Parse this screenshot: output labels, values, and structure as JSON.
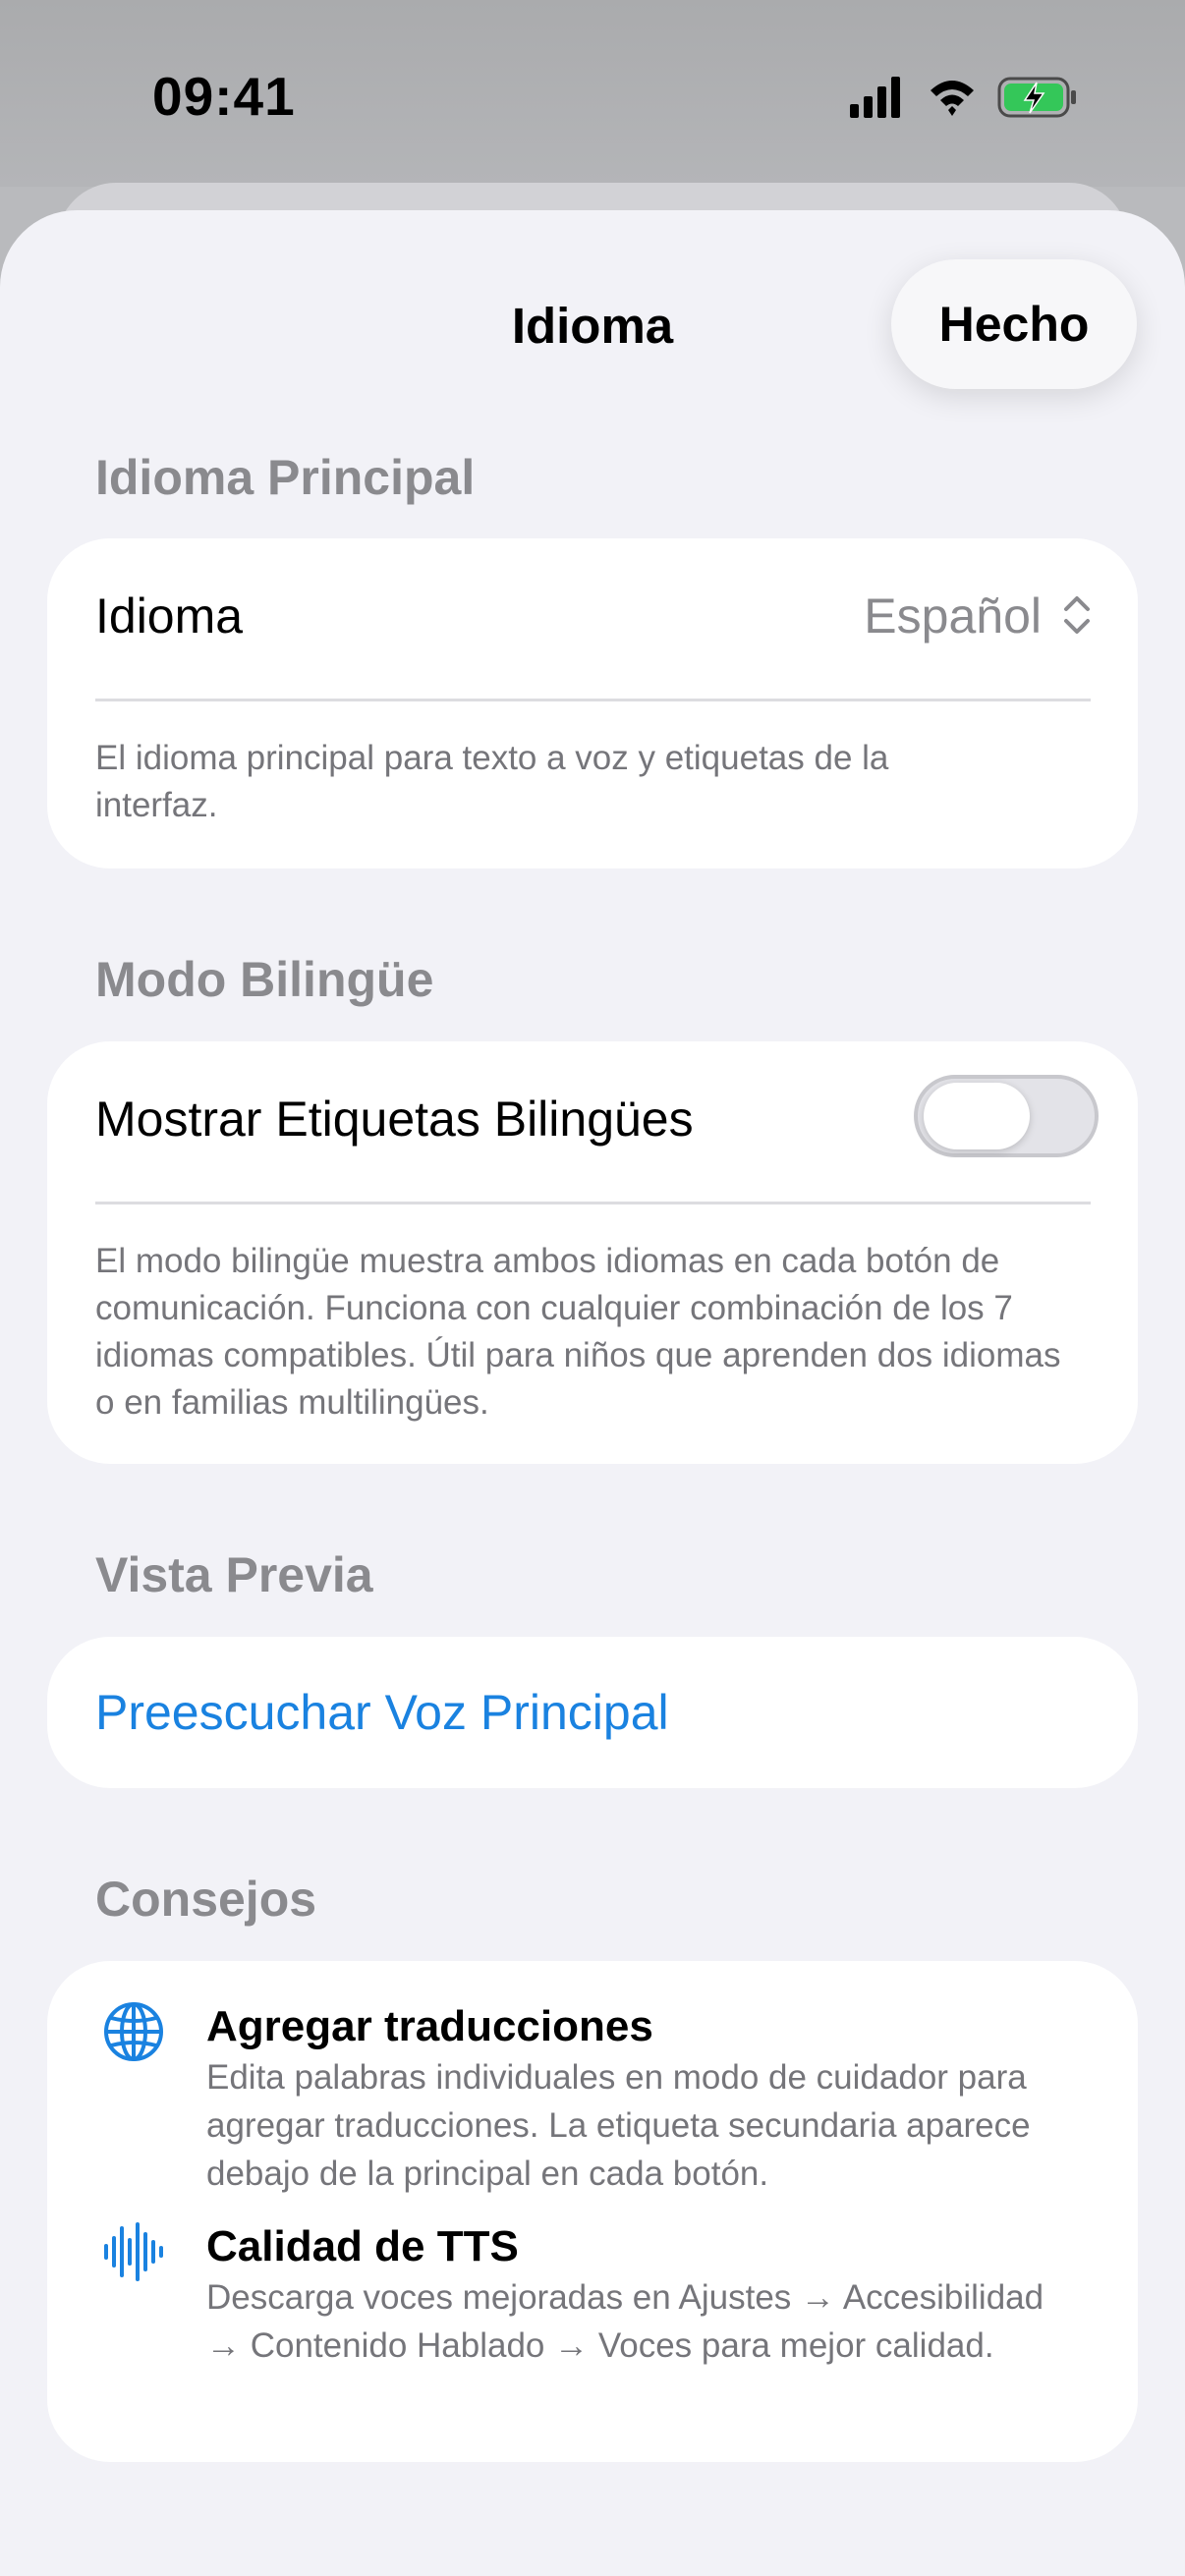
{
  "status_bar": {
    "time": "09:41"
  },
  "nav": {
    "title": "Idioma",
    "done_label": "Hecho"
  },
  "primary_language": {
    "header": "Idioma Principal",
    "row_label": "Idioma",
    "row_value": "Español",
    "footnote": "El idioma principal para texto a voz y etiquetas de la interfaz."
  },
  "bilingual": {
    "header": "Modo Bilingüe",
    "toggle_label": "Mostrar Etiquetas Bilingües",
    "toggle_on": false,
    "footnote": "El modo bilingüe muestra ambos idiomas en cada botón de comunicación. Funciona con cualquier combinación de los 7 idiomas compatibles. Útil para niños que aprenden dos idiomas o en familias multilingües."
  },
  "preview": {
    "header": "Vista Previa",
    "button_label": "Preescuchar Voz Principal"
  },
  "tips": {
    "header": "Consejos",
    "items": [
      {
        "icon": "globe-icon",
        "title": "Agregar traducciones",
        "text": "Edita palabras individuales en modo de cuidador para agregar traducciones. La etiqueta secundaria aparece debajo de la principal en cada botón."
      },
      {
        "icon": "waveform-icon",
        "title": "Calidad de TTS",
        "text": "Descarga voces mejoradas en Ajustes → Accesibilidad → Contenido Hablado → Voces para mejor calidad."
      }
    ]
  },
  "colors": {
    "accent": "#1a82e0",
    "secondary_text": "#8a8a8e",
    "background": "#f2f2f7",
    "battery_green": "#34c759"
  }
}
